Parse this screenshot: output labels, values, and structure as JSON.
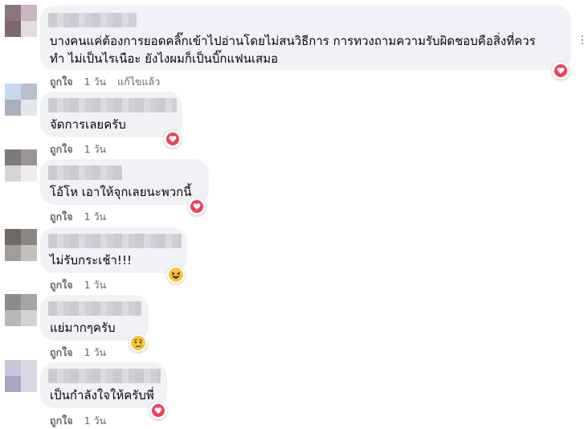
{
  "comments": [
    {
      "text_lines": [
        "บางคนแค่ต้องการยอดคลิ๊กเข้าไปอ่านโดยไม่สนวิธีการ การทวงถามความรับผิดชอบคือสิ่งที่ควร",
        "ทำ ไม่เป็นไรเนือะ ยังไงผมก็เป็นบิ๊กแฟนเสมอ"
      ],
      "like": "ถูกใจ",
      "time": "1 วัน",
      "edited": "แก้ไขแล้ว",
      "reaction": "heart-icon",
      "avatar": [
        "#8e7481",
        "#c9b6c0",
        "#7a6a70",
        "#e3dde0"
      ]
    },
    {
      "text_lines": [
        "จัดการเลยครับ"
      ],
      "like": "ถูกใจ",
      "time": "1 วัน",
      "reaction": "heart-icon",
      "avatar": [
        "#c7d9ec",
        "#b7c0cc",
        "#aab0bb",
        "#e3e6ea"
      ]
    },
    {
      "text_lines": [
        "โอ้โห เอาให้จุกเลยนะพวกนี้"
      ],
      "like": "ถูกใจ",
      "time": "1 วัน",
      "reaction": "heart-icon",
      "avatar": [
        "#7f7a7a",
        "#9a9697",
        "#d7d4d5",
        "#eeecec"
      ]
    },
    {
      "text_lines": [
        "ไม่รับกระเช้า!!!"
      ],
      "like": "ถูกใจ",
      "time": "1 วัน",
      "reaction": "laughing-emoji-icon",
      "avatar": [
        "#6f6965",
        "#8b8583",
        "#a19d9a",
        "#c4c0bd"
      ]
    },
    {
      "text_lines": [
        "แย่มากๆครับ"
      ],
      "like": "ถูกใจ",
      "time": "1 วัน",
      "reaction": "sad-emoji-icon",
      "avatar": [
        "#8b8d8c",
        "#a4a6a5",
        "#b7b8b8",
        "#d2d3d3"
      ]
    },
    {
      "text_lines": [
        "เป็นกำลังใจให้ครับพี่"
      ],
      "like": "ถูกใจ",
      "time": "1 วัน",
      "reaction": "heart-icon",
      "avatar": [
        "#c9c6d9",
        "#dad8e4",
        "#a9a6c2",
        "#d9d7e3"
      ]
    }
  ],
  "more_options_icon": "more-options-icon"
}
